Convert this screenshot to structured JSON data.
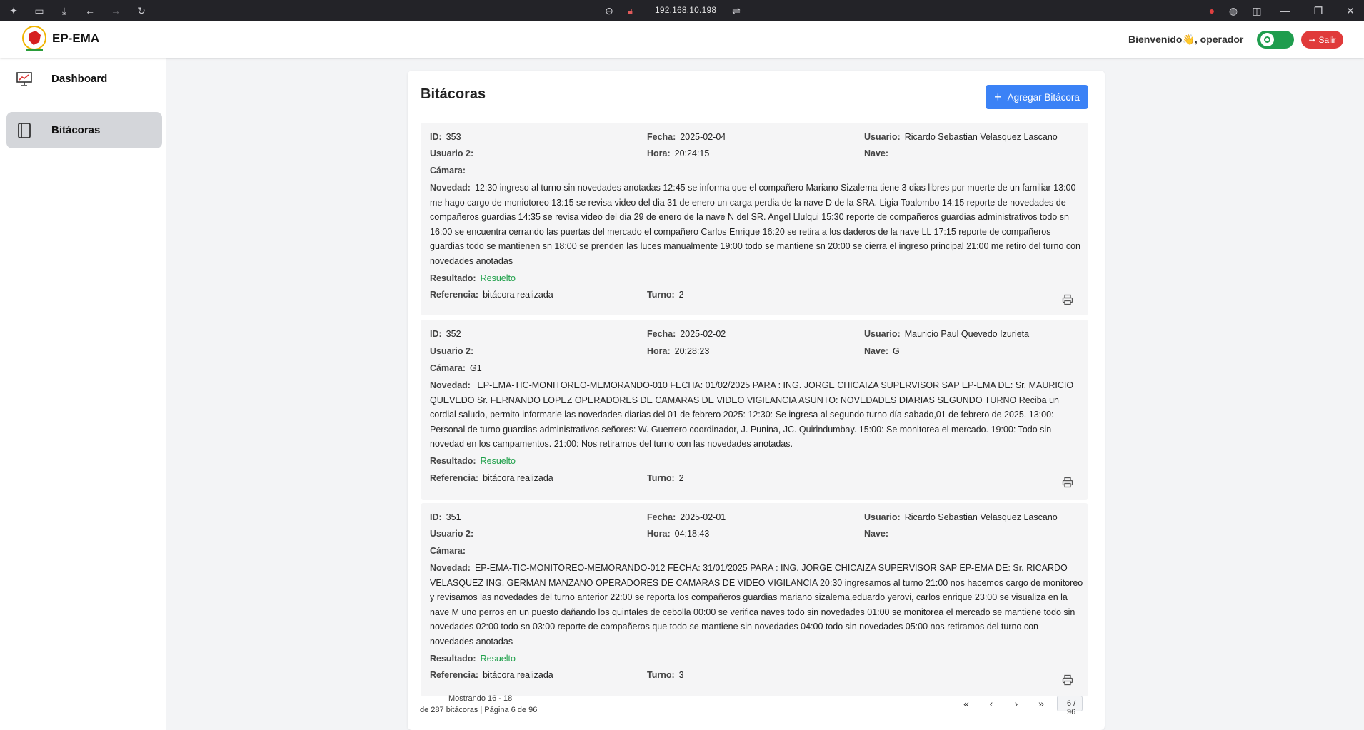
{
  "browser": {
    "url": "192.168.10.198"
  },
  "header": {
    "brand": "EP-EMA",
    "welcome": "Bienvenido👋, operador",
    "logout": "Salir"
  },
  "sidebar": {
    "items": [
      {
        "label": "Dashboard"
      },
      {
        "label": "Bitácoras"
      }
    ]
  },
  "page": {
    "title": "Bitácoras",
    "add_button": "Agregar Bitácora"
  },
  "labels": {
    "id": "ID:",
    "fecha": "Fecha:",
    "usuario": "Usuario:",
    "usuario2": "Usuario 2:",
    "hora": "Hora:",
    "nave": "Nave:",
    "camara": "Cámara:",
    "novedad": "Novedad:",
    "resultado": "Resultado:",
    "referencia": "Referencia:",
    "turno": "Turno:"
  },
  "records": [
    {
      "id": "353",
      "fecha": "2025-02-04",
      "usuario": "Ricardo Sebastian Velasquez Lascano",
      "usuario2": "",
      "hora": "20:24:15",
      "nave": "",
      "camara": "",
      "novedad": "12:30 ingreso al turno sin novedades anotadas 12:45 se informa que el compañero Mariano Sizalema tiene 3 dias libres por muerte de un familiar 13:00 me hago cargo de moniotoreo 13:15 se revisa video del dia 31 de enero un carga perdia de la nave D de la SRA. Ligia Toalombo 14:15 reporte de novedades de compañeros guardias 14:35 se revisa video del dia 29 de enero de la nave N del SR. Angel Llulqui 15:30 reporte de compañeros guardias administrativos todo sn 16:00 se encuentra cerrando las puertas del mercado el compañero Carlos Enrique 16:20 se retira a los daderos de la nave LL 17:15 reporte de compañeros guardias todo se mantienen sn 18:00 se prenden las luces manualmente 19:00 todo se mantiene sn 20:00 se cierra el ingreso principal 21:00 me retiro del turno con novedades anotadas",
      "resultado": "Resuelto",
      "referencia": "bitácora realizada",
      "turno": "2"
    },
    {
      "id": "352",
      "fecha": "2025-02-02",
      "usuario": "Mauricio Paul Quevedo Izurieta",
      "usuario2": "",
      "hora": "20:28:23",
      "nave": "G",
      "camara": "G1",
      "novedad": " EP-EMA-TIC-MONITOREO-MEMORANDO-010 FECHA: 01/02/2025 PARA : ING. JORGE CHICAIZA SUPERVISOR SAP EP-EMA DE: Sr. MAURICIO QUEVEDO Sr. FERNANDO LOPEZ OPERADORES DE CAMARAS DE VIDEO VIGILANCIA ASUNTO: NOVEDADES DIARIAS SEGUNDO TURNO Reciba un cordial saludo, permito informarle las novedades diarias del 01 de febrero 2025: 12:30: Se ingresa al segundo turno día sabado,01 de febrero de 2025. 13:00: Personal de turno guardias administrativos señores: W. Guerrero coordinador, J. Punina, JC. Quirindumbay. 15:00: Se monitorea el mercado. 19:00: Todo sin novedad en los campamentos. 21:00: Nos retiramos del turno con las novedades anotadas.",
      "resultado": "Resuelto",
      "referencia": "bitácora realizada",
      "turno": "2"
    },
    {
      "id": "351",
      "fecha": "2025-02-01",
      "usuario": "Ricardo Sebastian Velasquez Lascano",
      "usuario2": "",
      "hora": "04:18:43",
      "nave": "",
      "camara": "",
      "novedad": "EP-EMA-TIC-MONITOREO-MEMORANDO-012 FECHA: 31/01/2025 PARA : ING. JORGE CHICAIZA SUPERVISOR SAP EP-EMA DE: Sr. RICARDO VELASQUEZ ING. GERMAN MANZANO OPERADORES DE CAMARAS DE VIDEO VIGILANCIA 20:30 ingresamos al turno 21:00 nos hacemos cargo de monitoreo y revisamos las novedades del turno anterior 22:00 se reporta los compañeros guardias mariano sizalema,eduardo yerovi, carlos enrique 23:00 se visualiza en la nave M uno perros en un puesto dañando los quintales de cebolla 00:00 se verifica naves todo sin novedades 01:00 se monitorea el mercado se mantiene todo sin novedades 02:00 todo sn 03:00 reporte de compañeros que todo se mantiene sin novedades 04:00 todo sin novedades 05:00 nos retiramos del turno con novedades anotadas",
      "resultado": "Resuelto",
      "referencia": "bitácora realizada",
      "turno": "3"
    }
  ],
  "pagination": {
    "showing": "Mostrando 16 - 18",
    "summary": "de 287 bitácoras | Página 6 de 96",
    "page_total": "6 / 96",
    "input_value": ""
  },
  "colors": {
    "accent": "#3b82f6",
    "danger": "#e03a3a",
    "success": "#1fa04a"
  }
}
